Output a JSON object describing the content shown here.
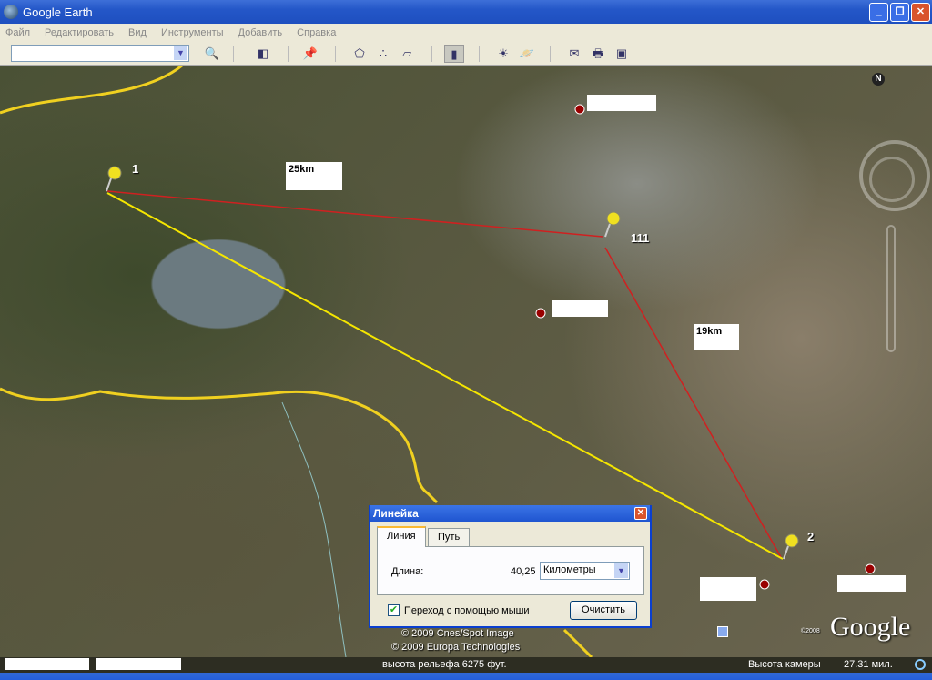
{
  "window": {
    "title": "Google Earth"
  },
  "menu": [
    "Файл",
    "Редактировать",
    "Вид",
    "Инструменты",
    "Добавить",
    "Справка"
  ],
  "search": {
    "value": ""
  },
  "map": {
    "pins": [
      {
        "label": "1"
      },
      {
        "label": "111"
      },
      {
        "label": "2"
      }
    ],
    "distance_labels": [
      "25km",
      "19km"
    ],
    "compass": "N",
    "copyright": [
      "© 2009 Cnes/Spot Image",
      "© 2009 Europa Technologies"
    ],
    "logo": "Google",
    "logo_year": "©2008"
  },
  "ruler": {
    "title": "Линейка",
    "tabs": [
      "Линия",
      "Путь"
    ],
    "length_label": "Длина:",
    "length_value": "40,25",
    "unit": "Километры",
    "mouse_nav_label": "Переход с помощью мыши",
    "mouse_nav_checked": true,
    "clear_button": "Очистить"
  },
  "status": {
    "elevation": "высота рельефа  6275 фут.",
    "camera_label": "Высота камеры",
    "camera_value": "27.31 мил."
  },
  "colors": {
    "ruler_line": "#f5e600",
    "red_line": "#d02020",
    "border": "#f0d020"
  }
}
